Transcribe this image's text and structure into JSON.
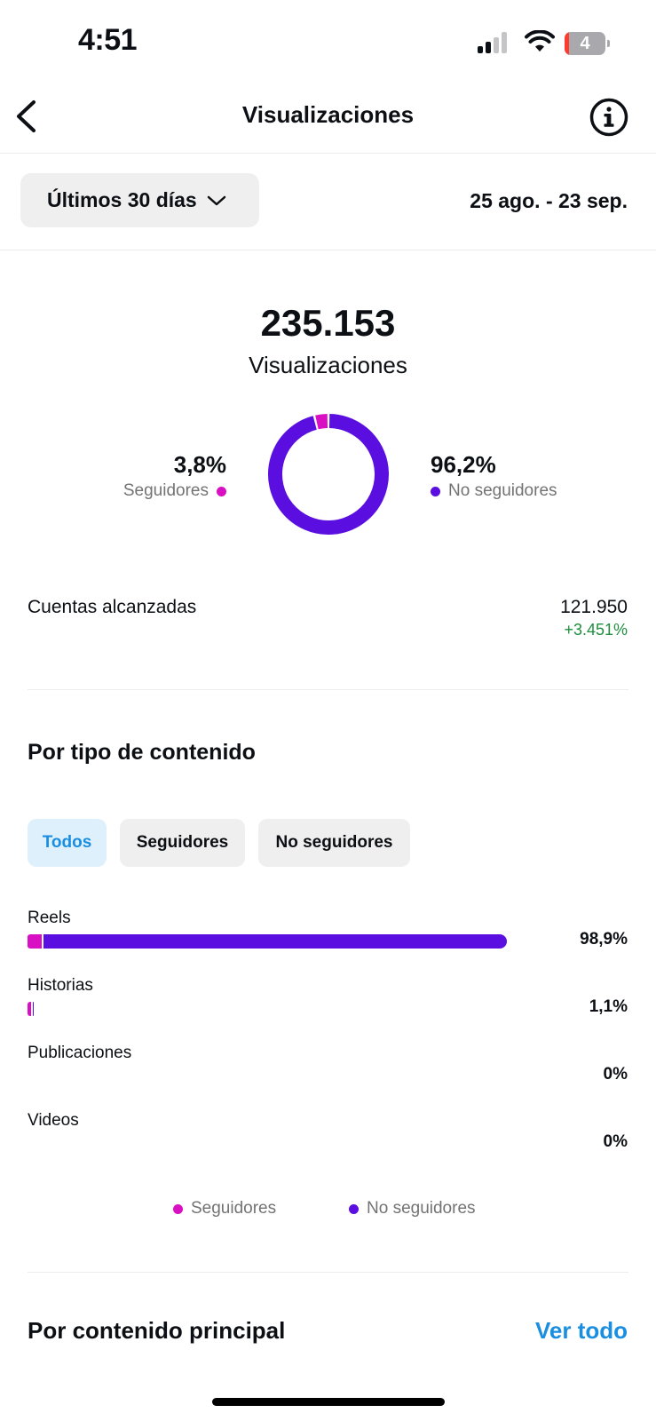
{
  "status_bar": {
    "time": "4:51",
    "battery": "4"
  },
  "header": {
    "title": "Visualizaciones"
  },
  "filter": {
    "range_label": "Últimos 30 días",
    "date_range": "25 ago. - 23 sep."
  },
  "summary": {
    "total": "235.153",
    "total_label": "Visualizaciones",
    "followers_pct": "3,8%",
    "followers_label": "Seguidores",
    "non_followers_pct": "96,2%",
    "non_followers_label": "No seguidores",
    "followers_fraction": 0.038
  },
  "reach": {
    "label": "Cuentas alcanzadas",
    "value": "121.950",
    "change": "+3.451%"
  },
  "content_type": {
    "title": "Por tipo de contenido",
    "tabs": [
      "Todos",
      "Seguidores",
      "No seguidores"
    ],
    "rows": [
      {
        "label": "Reels",
        "pct": "98,9%",
        "share": 0.989,
        "followers_share": 0.03
      },
      {
        "label": "Historias",
        "pct": "1,1%",
        "share": 0.011,
        "followers_share": 0.6
      },
      {
        "label": "Publicaciones",
        "pct": "0%",
        "share": 0,
        "followers_share": 0
      },
      {
        "label": "Videos",
        "pct": "0%",
        "share": 0,
        "followers_share": 0
      }
    ],
    "legend": [
      "Seguidores",
      "No seguidores"
    ]
  },
  "top_content": {
    "title": "Por contenido principal",
    "see_all": "Ver todo"
  },
  "colors": {
    "followers": "#d90fc3",
    "non_followers": "#5a0fe0",
    "accent": "#1a8ee0",
    "positive": "#1e8e3e"
  }
}
